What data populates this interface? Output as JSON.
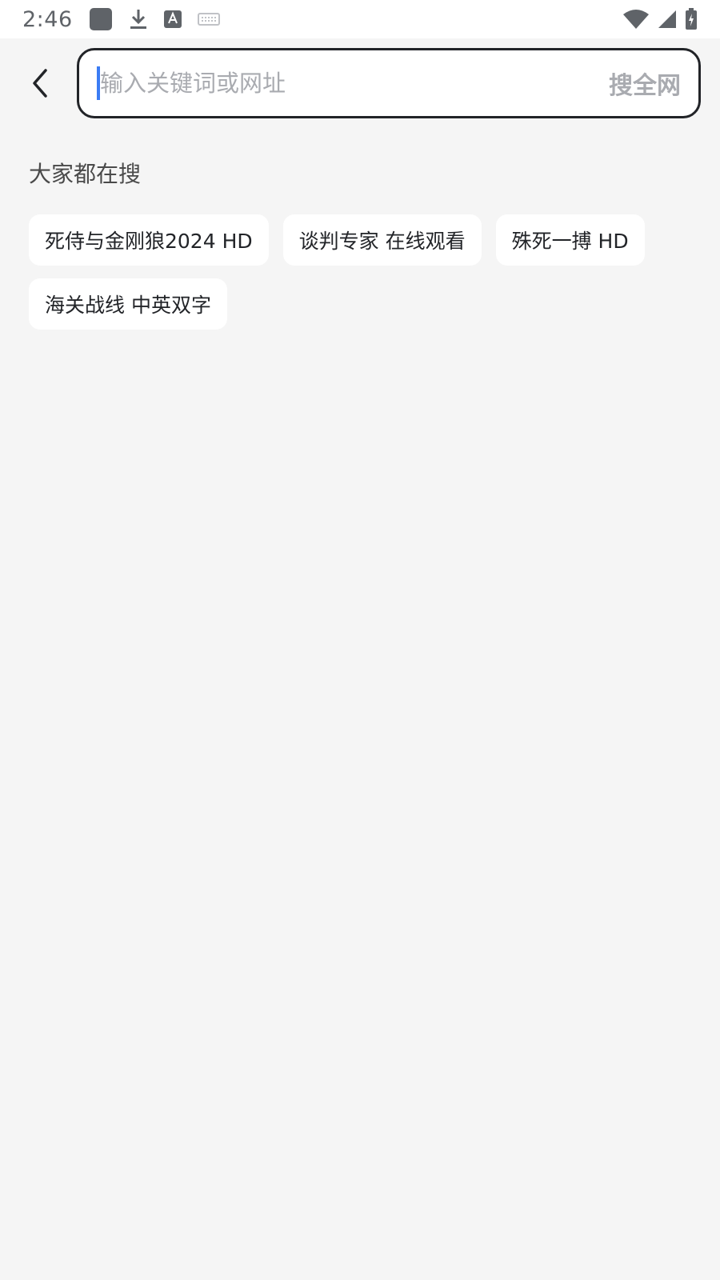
{
  "status_bar": {
    "time": "2:46",
    "left_icons": [
      "app-square-icon",
      "download-icon",
      "font-a-icon",
      "keyboard-icon"
    ],
    "right_icons": [
      "wifi-icon",
      "cellular-signal-icon",
      "battery-charging-icon"
    ]
  },
  "search": {
    "placeholder": "输入关键词或网址",
    "value": "",
    "search_all_label": "搜全网"
  },
  "trending": {
    "title": "大家都在搜",
    "tags": [
      "死侍与金刚狼2024 HD",
      "谈判专家 在线观看",
      "殊死一搏 HD",
      "海关战线 中英双字"
    ]
  },
  "colors": {
    "background": "#f5f5f5",
    "caret": "#3b7cf4",
    "border": "#222428",
    "placeholder": "#a9abb0"
  }
}
